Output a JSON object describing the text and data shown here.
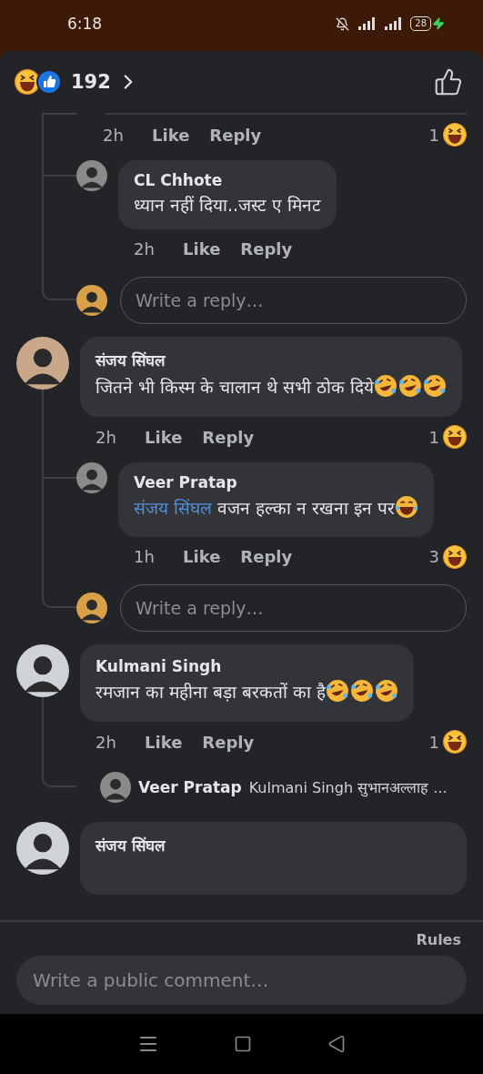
{
  "status_bar": {
    "time": "6:18",
    "battery": "28"
  },
  "header": {
    "reaction_count": "192"
  },
  "thread": [
    {
      "kind": "hidden",
      "replies": [
        {
          "kind": "cut",
          "meta": {
            "time": "2h",
            "actions": [
              "Like",
              "Reply"
            ],
            "reactions": "1"
          }
        },
        {
          "kind": "comment",
          "author": "CL Chhote",
          "text": "ध्यान नहीं दिया..जस्ट ए मिनट",
          "meta": {
            "time": "2h",
            "actions": [
              "Like",
              "Reply"
            ]
          }
        }
      ],
      "reply_field": {
        "placeholder": "Write a reply…"
      }
    },
    {
      "kind": "comment",
      "author": "संजय सिंघल",
      "text": "जितने भी किस्म के चालान थे सभी ठोक दिये",
      "emojis": [
        {
          "kind": "rofl"
        },
        {
          "kind": "rofl"
        },
        {
          "kind": "rofl"
        }
      ],
      "meta": {
        "time": "2h",
        "actions": [
          "Like",
          "Reply"
        ],
        "reactions": "1"
      },
      "replies": [
        {
          "kind": "comment",
          "author": "Veer Pratap",
          "mention": "संजय सिंघल",
          "text": "वजन हल्का न रखना इन पर",
          "emojis": [
            {
              "kind": "joy"
            }
          ],
          "meta": {
            "time": "1h",
            "actions": [
              "Like",
              "Reply"
            ],
            "reactions": "3"
          }
        }
      ],
      "reply_field": {
        "placeholder": "Write a reply…"
      }
    },
    {
      "kind": "comment",
      "author": "Kulmani Singh",
      "text": "रमजान का महीना बड़ा बरकतों का है",
      "emojis": [
        {
          "kind": "rofl"
        },
        {
          "kind": "rofl"
        },
        {
          "kind": "rofl"
        }
      ],
      "meta": {
        "time": "2h",
        "actions": [
          "Like",
          "Reply"
        ],
        "reactions": "1"
      },
      "replies": [
        {
          "kind": "preview",
          "author": "Veer Pratap",
          "text": "Kulmani Singh सुभानअल्लाह ..."
        }
      ]
    },
    {
      "kind": "cut",
      "author": "संजय सिंघल"
    }
  ],
  "footer": {
    "rules": "Rules",
    "comment_field": {
      "placeholder": "Write a public comment…"
    }
  }
}
